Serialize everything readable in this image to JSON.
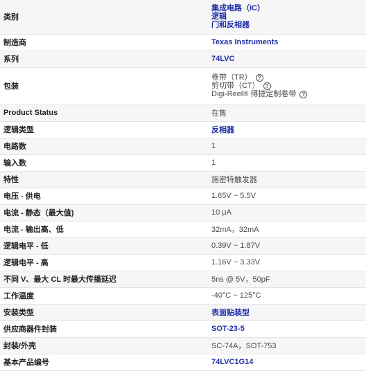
{
  "specs": {
    "category": {
      "label": "类别",
      "lines": [
        "集成电路（IC）",
        "逻辑",
        "门和反相器"
      ]
    },
    "manufacturer": {
      "label": "制造商",
      "value": "Texas Instruments"
    },
    "series": {
      "label": "系列",
      "value": "74LVC"
    },
    "packaging": {
      "label": "包装",
      "lines": [
        "卷带（TR）",
        "剪切带（CT）",
        "Digi-Reel® 得捷定制卷带"
      ]
    },
    "product_status": {
      "label": "Product Status",
      "value": "在售"
    },
    "logic_type": {
      "label": "逻辑类型",
      "value": "反相器"
    },
    "num_circuits": {
      "label": "电路数",
      "value": "1"
    },
    "num_inputs": {
      "label": "输入数",
      "value": "1"
    },
    "features": {
      "label": "特性",
      "value": "施密特触发器"
    },
    "voltage_supply": {
      "label": "电压 - 供电",
      "value": "1.65V ~ 5.5V"
    },
    "current_quiescent": {
      "label": "电流 - 静态（最大值)",
      "value": "10 µA"
    },
    "current_output": {
      "label": "电流 - 输出高、低",
      "value": "32mA，32mA"
    },
    "logic_level_low": {
      "label": "逻辑电平 - 低",
      "value": "0.39V ~ 1.87V"
    },
    "logic_level_high": {
      "label": "逻辑电平 - 高",
      "value": "1.16V ~ 3.33V"
    },
    "max_prop_delay": {
      "label": "不同 V、最大 CL 时最大传播延迟",
      "value": "5ns @ 5V，50pF"
    },
    "operating_temp": {
      "label": "工作温度",
      "value": "-40°C ~ 125°C"
    },
    "mounting_type": {
      "label": "安装类型",
      "value": "表面贴装型"
    },
    "supplier_package": {
      "label": "供应商器件封装",
      "value": "SOT-23-5"
    },
    "package_case": {
      "label": "封装/外壳",
      "value": "SC-74A，SOT-753"
    },
    "base_product": {
      "label": "基本产品编号",
      "value": "74LVC1G14"
    }
  }
}
